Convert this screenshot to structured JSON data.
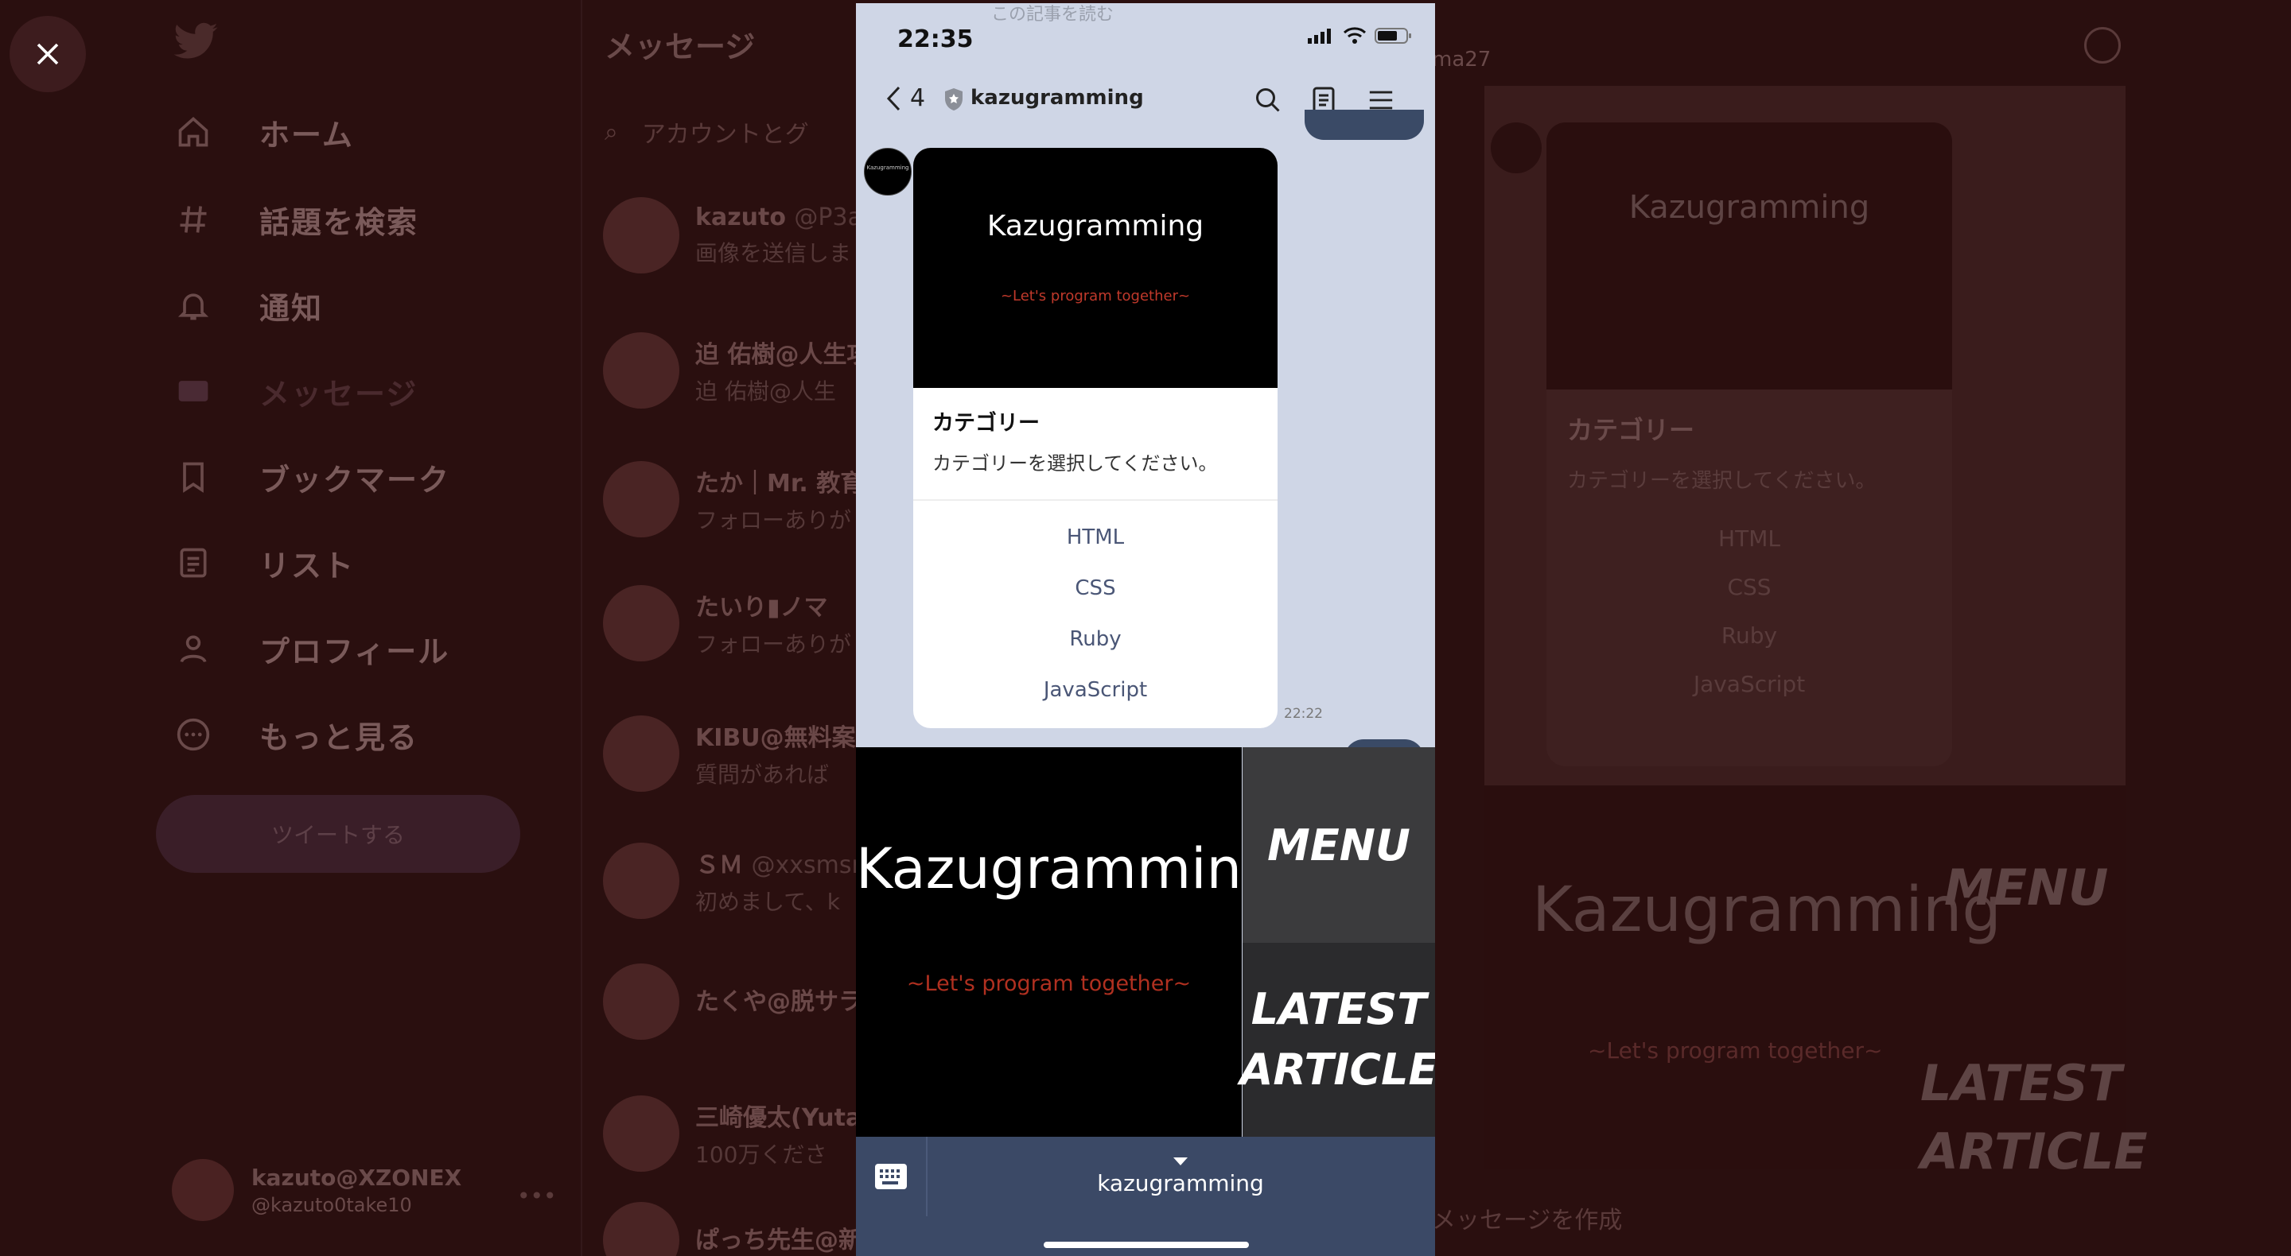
{
  "twitter": {
    "nav": [
      {
        "label": "ホーム",
        "icon": "home-icon"
      },
      {
        "label": "話題を検索",
        "icon": "hashtag-icon"
      },
      {
        "label": "通知",
        "icon": "bell-icon"
      },
      {
        "label": "メッセージ",
        "icon": "mail-icon"
      },
      {
        "label": "ブックマーク",
        "icon": "bookmark-icon"
      },
      {
        "label": "リスト",
        "icon": "list-icon"
      },
      {
        "label": "プロフィール",
        "icon": "profile-icon"
      },
      {
        "label": "もっと見る",
        "icon": "more-icon"
      }
    ],
    "tweet_button": "ツイートする",
    "profile": {
      "name": "kazuto@XZONEX",
      "handle": "@kazuto0take10"
    },
    "messages_title": "メッセージ",
    "search_placeholder": "アカウントとグ",
    "conversations": [
      {
        "name": "kazuto",
        "handle": "@P3a",
        "preview": "画像を送信しま"
      },
      {
        "name": "迫 佑樹@人生攻",
        "handle": "",
        "preview": "迫 佑樹@人生"
      },
      {
        "name": "たか｜Mr. 教育",
        "handle": "",
        "preview": "フォローありが"
      },
      {
        "name": "たいり▮ノマ",
        "handle": "",
        "preview": "フォローありが"
      },
      {
        "name": "KIBU@無料案",
        "handle": "",
        "preview": "質問があれば"
      },
      {
        "name": "ＳＭ",
        "handle": "@xxsmsm",
        "preview": "初めまして、k"
      },
      {
        "name": "たくや@脱サラ",
        "handle": "",
        "preview": ""
      },
      {
        "name": "三崎優太(Yuta",
        "handle": "",
        "preview": "100万くださ"
      },
      {
        "name": "ぱっち先生@新",
        "handle": "",
        "preview": ""
      }
    ],
    "right_pane": {
      "header_handle": "ma27",
      "card_title": "Kazugramming",
      "card_heading": "カテゴリー",
      "card_sub": "カテゴリーを選択してください。",
      "options": [
        "HTML",
        "CSS",
        "Ruby",
        "JavaScript"
      ],
      "banner_title": "Kazugramming",
      "banner_tagline": "~Let's program together~",
      "menu_label": "MENU",
      "latest_label": "LATEST ARTICLE",
      "input_placeholder": "メッセージを作成"
    }
  },
  "phone": {
    "faded_top": "この記事を読む",
    "status": {
      "time": "22:35"
    },
    "header": {
      "back_count": "4",
      "title": "kazugramming"
    },
    "card": {
      "hero_title": "Kazugramming",
      "hero_tagline": "~Let's program together~",
      "title": "カテゴリー",
      "subtitle": "カテゴリーを選択してください。",
      "options": [
        "HTML",
        "CSS",
        "Ruby",
        "JavaScript"
      ],
      "time": "22:22",
      "bot_avatar_text": "Kazugramming"
    },
    "rich_menu": {
      "main_title": "Kazugramming",
      "main_tagline": "~Let's program together~",
      "menu": "MENU",
      "latest_line1": "LATEST",
      "latest_line2": "ARTICLE"
    },
    "bottom_bar": {
      "menu_name": "kazugramming"
    }
  },
  "colors": {
    "overlay_bg": "#2a0f0f",
    "chat_bg": "#cfd6e6",
    "bottom_bar": "#3b4966",
    "option_text": "#4a5676",
    "tagline_red": "#b03020"
  }
}
